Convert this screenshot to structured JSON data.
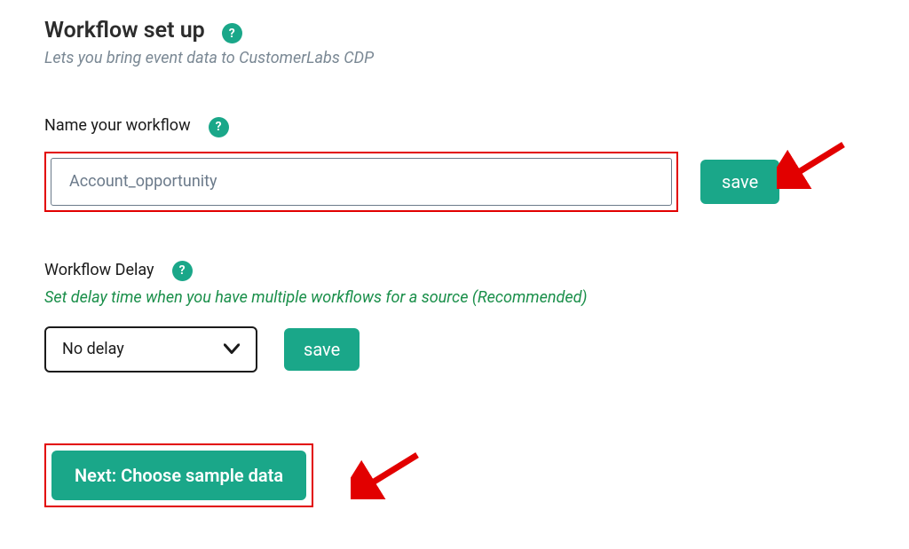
{
  "header": {
    "title": "Workflow set up",
    "subtitle": "Lets you bring event data to CustomerLabs CDP"
  },
  "name_section": {
    "label": "Name your workflow",
    "value": "Account_opportunity",
    "save_label": "save"
  },
  "delay_section": {
    "label": "Workflow Delay",
    "hint": "Set delay time when you have multiple workflows for a source (Recommended)",
    "selected": "No delay",
    "save_label": "save"
  },
  "next_button": {
    "label": "Next: Choose sample data"
  },
  "help_symbol": "?"
}
